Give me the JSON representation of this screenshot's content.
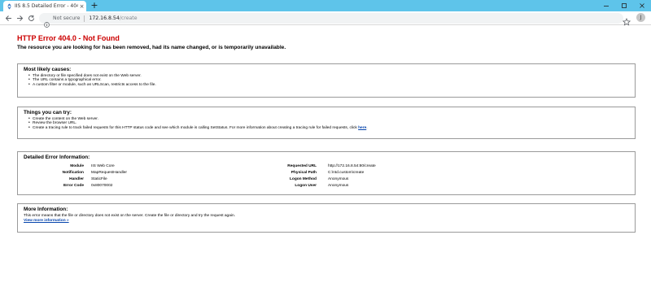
{
  "browser": {
    "tab": {
      "title": "IIS 8.5 Detailed Error - 404.0 - N",
      "close": "×"
    },
    "new_tab": "+",
    "address": {
      "security_label": "Not secure",
      "host": "172.16.8.54",
      "path": "/create"
    },
    "profile_initial": "J",
    "colors": {
      "tabstrip": "#5ec4ea",
      "omnibox": "#f1f3f4"
    }
  },
  "page": {
    "title": "HTTP Error 404.0 - Not Found",
    "subtitle": "The resource you are looking for has been removed, had its name changed, or is temporarily unavailable.",
    "causes": {
      "heading": "Most likely causes:",
      "items": [
        "The directory or file specified does not exist on the Web server.",
        "The URL contains a typographical error.",
        "A custom filter or module, such as URLScan, restricts access to the file."
      ]
    },
    "try": {
      "heading": "Things you can try:",
      "items": [
        "Create the content on the Web server.",
        "Review the browser URL.",
        "Create a tracing rule to track failed requests for this HTTP status code and see which module is calling SetStatus. For more information about creating a tracing rule for failed requests, click "
      ],
      "link_text": "here",
      "link_suffix": "."
    },
    "details": {
      "heading": "Detailed Error Information:",
      "left": [
        {
          "label": "Module",
          "value": "IIS Web Core"
        },
        {
          "label": "Notification",
          "value": "MapRequestHandler"
        },
        {
          "label": "Handler",
          "value": "StaticFile"
        },
        {
          "label": "Error Code",
          "value": "0x80070002"
        }
      ],
      "right": [
        {
          "label": "Requested URL",
          "value": "http://172.16.8.54:80/create"
        },
        {
          "label": "Physical Path",
          "value": "C:\\ntd.custom\\create"
        },
        {
          "label": "Logon Method",
          "value": "Anonymous"
        },
        {
          "label": "Logon User",
          "value": "Anonymous"
        }
      ]
    },
    "more": {
      "heading": "More Information:",
      "text": "This error means that the file or directory does not exist on the server. Create the file or directory and try the request again.",
      "link": "View more information »"
    },
    "colors": {
      "title": "#cc0000",
      "link": "#0645ad",
      "border": "#9a9a9a"
    }
  }
}
